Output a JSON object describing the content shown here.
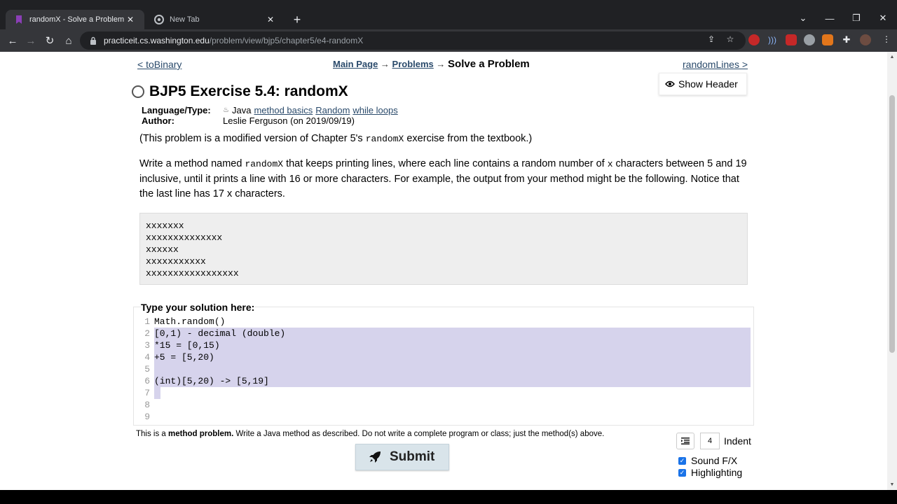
{
  "browser": {
    "tabs": [
      {
        "title": "randomX - Solve a Problem - Pra",
        "active": true
      },
      {
        "title": "New Tab",
        "active": false
      }
    ],
    "url": {
      "host": "practiceit.cs.washington.edu",
      "path": "/problem/view/bjp5/chapter5/e4-randomX"
    }
  },
  "nav": {
    "prev": "< toBinary",
    "next": "randomLines >",
    "crumb_main": "Main Page",
    "crumb_arrow": "→",
    "crumb_problems": "Problems",
    "crumb_current": "Solve a Problem"
  },
  "show_header": "Show Header",
  "problem": {
    "title": "BJP5 Exercise 5.4: randomX",
    "language_label": "Language/Type:",
    "language": "Java",
    "tags": [
      "method basics",
      "Random",
      "while loops"
    ],
    "author_label": "Author:",
    "author": "Leslie Ferguson (on 2019/09/19)",
    "intro_prefix": "(This problem is a modified version of Chapter 5's ",
    "intro_code": "randomX",
    "intro_suffix": " exercise from the textbook.)",
    "desc_prefix": "Write a method named ",
    "desc_code": "randomX",
    "desc_mid": " that keeps printing lines, where each line contains a random number of ",
    "desc_x": "x",
    "desc_suffix": " characters between 5 and 19 inclusive, until it prints a line with 16 or more characters. For example, the output from your method might be the following. Notice that the last line has 17 x characters.",
    "sample_output": [
      "xxxxxxx",
      "xxxxxxxxxxxxxx",
      "xxxxxx",
      "xxxxxxxxxxx",
      "xxxxxxxxxxxxxxxxx"
    ]
  },
  "solution": {
    "label": "Type your solution here:",
    "lines": [
      "Math.random()",
      "[0,1) - decimal (double)",
      "*15 = [0,15)",
      "+5 = [5,20)",
      "",
      "(int)[5,20) -> [5,19]",
      "",
      "",
      ""
    ]
  },
  "footer": {
    "note_prefix": "This is a ",
    "note_bold": "method problem.",
    "note_suffix": " Write a Java method as described. Do not write a complete program or class; just the method(s) above.",
    "submit": "Submit",
    "indent_value": "4",
    "indent_label": "Indent",
    "sound_label": "Sound F/X",
    "highlight_label": "Highlighting"
  }
}
